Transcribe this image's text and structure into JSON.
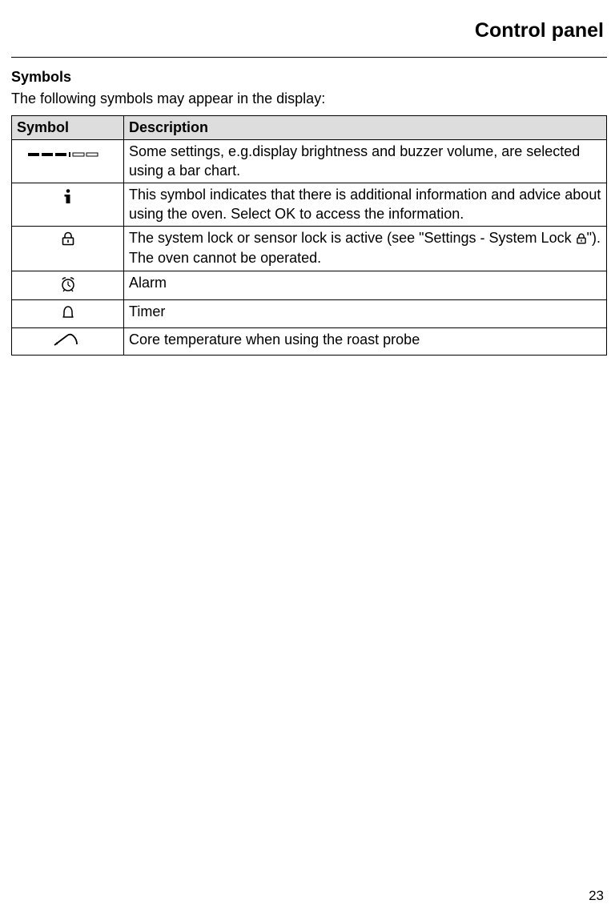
{
  "header": {
    "title": "Control panel"
  },
  "section": {
    "heading": "Symbols"
  },
  "intro": "The following symbols may appear in the display:",
  "table": {
    "headers": {
      "symbol": "Symbol",
      "description": "Description"
    },
    "rows": [
      {
        "icon": "bar-chart-icon",
        "description": "Some settings, e.g.display brightness and buzzer volume, are selected using a bar chart."
      },
      {
        "icon": "info-icon",
        "description": "This symbol indicates that there is additional information and advice about using the oven. Select OK to access the information."
      },
      {
        "icon": "lock-icon",
        "description_pre": "The system lock or sensor lock is active (see \"Settings - System Lock ",
        "description_post": "\"). The oven cannot be operated."
      },
      {
        "icon": "alarm-icon",
        "description": "Alarm"
      },
      {
        "icon": "timer-icon",
        "description": "Timer"
      },
      {
        "icon": "probe-icon",
        "description": "Core temperature when using the roast probe"
      }
    ]
  },
  "footer": {
    "page_number": "23"
  }
}
